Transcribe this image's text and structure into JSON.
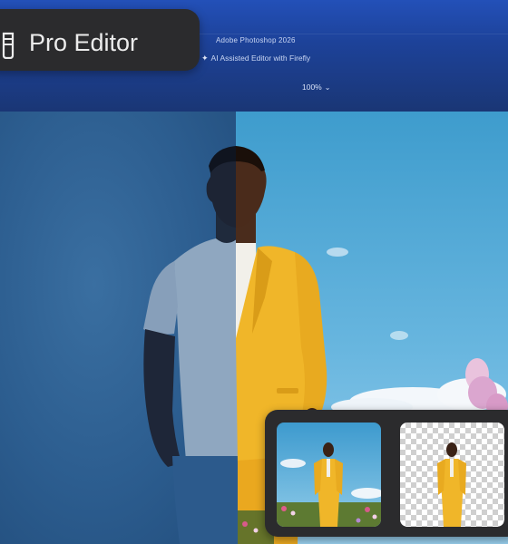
{
  "header": {
    "app_title": "Adobe Photoshop 2026",
    "ai_label": "AI Assisted Editor with Firefly",
    "zoom_value": "100%"
  },
  "mode_pill": {
    "label": "Pro Editor",
    "icon": "brush-tools-icon"
  },
  "canvas": {
    "left_panel": "original",
    "right_panel": "edited"
  },
  "thumbnails": [
    {
      "name": "original-preview"
    },
    {
      "name": "background-removed-preview"
    }
  ],
  "colors": {
    "pill_bg": "#2b2b2d",
    "header_blue": "#1d4299",
    "suit_yellow": "#f0b629",
    "sky_blue": "#5fb2dd",
    "wall_blue": "#2c5d8f"
  }
}
